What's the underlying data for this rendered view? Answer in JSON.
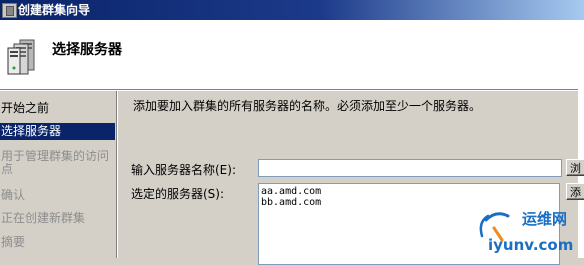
{
  "window": {
    "title": "创建群集向导"
  },
  "header": {
    "title": "选择服务器"
  },
  "nav": {
    "items": [
      {
        "label": "开始之前",
        "state": "done"
      },
      {
        "label": "选择服务器",
        "state": "selected"
      },
      {
        "label": "用于管理群集的访问点",
        "state": "pending"
      },
      {
        "label": "确认",
        "state": "pending"
      },
      {
        "label": "正在创建新群集",
        "state": "pending"
      },
      {
        "label": "摘要",
        "state": "pending"
      }
    ]
  },
  "main": {
    "description": "添加要加入群集的所有服务器的名称。必须添加至少一个服务器。",
    "server_name_label": "输入服务器名称(E):",
    "server_name_value": "",
    "selected_servers_label": "选定的服务器(S):",
    "selected_servers": [
      "aa.amd.com",
      "bb.amd.com"
    ],
    "browse_button_label": "浏览",
    "add_button_label": "添加"
  },
  "watermark": {
    "cn": "运维网",
    "url": "iyunv.com"
  },
  "colors": {
    "titlebar": "#0a246a",
    "selection": "#0a246a",
    "watermark_blue": "#1a6fc4",
    "watermark_orange": "#f08a1c"
  }
}
